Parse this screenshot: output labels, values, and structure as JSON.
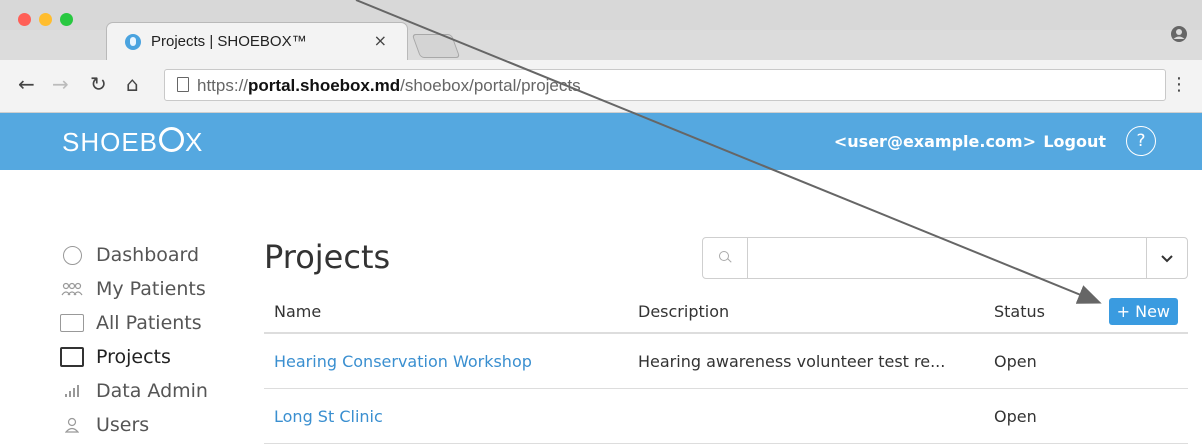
{
  "browser": {
    "tab_title": "Projects | SHOEBOX™",
    "tab_close": "×",
    "url_prefix": "https://",
    "url_host": "portal.shoebox.md",
    "url_path": "/shoebox/portal/projects"
  },
  "header": {
    "brand_pre": "SHOEB",
    "brand_post": "X",
    "user": "<user@example.com>",
    "logout": "Logout",
    "help": "?"
  },
  "sidebar": {
    "items": [
      {
        "label": "Dashboard"
      },
      {
        "label": "My Patients"
      },
      {
        "label": "All Patients"
      },
      {
        "label": "Projects"
      },
      {
        "label": "Data Admin"
      },
      {
        "label": "Users"
      }
    ]
  },
  "main": {
    "title": "Projects",
    "search_placeholder": "",
    "columns": {
      "name": "Name",
      "description": "Description",
      "status": "Status"
    },
    "new_button": "+ New",
    "rows": [
      {
        "name": "Hearing Conservation Workshop",
        "description": "Hearing awareness volunteer test re...",
        "status": "Open"
      },
      {
        "name": "Long St Clinic",
        "description": "",
        "status": "Open"
      }
    ]
  },
  "colors": {
    "appbar": "#55a8e0",
    "link": "#3a8fd0",
    "new_button": "#3a9be0",
    "close_dot": "#ff5f57",
    "minimize_dot": "#ffbd2e",
    "maximize_dot": "#28c840"
  }
}
